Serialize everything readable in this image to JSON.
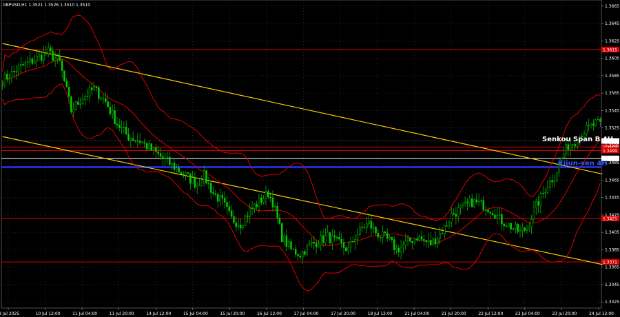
{
  "chart_data": {
    "type": "candlestick",
    "title": "GBPUSD,H1  1.3521 1.3526 1.3510 1.3510",
    "xlabel": "",
    "ylabel": "",
    "ylim": [
      1.3318,
      1.3672
    ],
    "y_ticks": [
      "1.3665",
      "1.3645",
      "1.3625",
      "1.3605",
      "1.3585",
      "1.3565",
      "1.3545",
      "1.3525",
      "1.3505",
      "1.3485",
      "1.3465",
      "1.3445",
      "1.3425",
      "1.3405",
      "1.3385",
      "1.3365",
      "1.3345",
      "1.3325"
    ],
    "x_ticks": [
      "9 Jul 2025",
      "10 Jul 12:00",
      "11 Jul 04:00",
      "11 Jul 20:00",
      "14 Jul 12:00",
      "15 Jul 04:00",
      "15 Jul 20:00",
      "16 Jul 12:00",
      "17 Jul 04:00",
      "17 Jul 20:00",
      "18 Jul 12:00",
      "21 Jul 04:00",
      "21 Jul 20:00",
      "22 Jul 12:00",
      "23 Jul 04:00",
      "23 Jul 20:00",
      "24 Jul 12:00"
    ],
    "bar_count": 262,
    "close_path": [
      [
        0,
        1.358
      ],
      [
        8,
        1.3595
      ],
      [
        15,
        1.3605
      ],
      [
        20,
        1.3612
      ],
      [
        25,
        1.36
      ],
      [
        30,
        1.3545
      ],
      [
        35,
        1.356
      ],
      [
        40,
        1.357
      ],
      [
        45,
        1.3555
      ],
      [
        50,
        1.353
      ],
      [
        55,
        1.3515
      ],
      [
        60,
        1.351
      ],
      [
        65,
        1.35
      ],
      [
        70,
        1.349
      ],
      [
        75,
        1.348
      ],
      [
        80,
        1.347
      ],
      [
        85,
        1.346
      ],
      [
        88,
        1.347
      ],
      [
        92,
        1.345
      ],
      [
        96,
        1.344
      ],
      [
        100,
        1.342
      ],
      [
        104,
        1.3415
      ],
      [
        108,
        1.343
      ],
      [
        112,
        1.344
      ],
      [
        116,
        1.345
      ],
      [
        118,
        1.344
      ],
      [
        122,
        1.34
      ],
      [
        126,
        1.3385
      ],
      [
        130,
        1.338
      ],
      [
        134,
        1.339
      ],
      [
        138,
        1.3395
      ],
      [
        142,
        1.34
      ],
      [
        145,
        1.3395
      ],
      [
        148,
        1.339
      ],
      [
        151,
        1.3385
      ],
      [
        154,
        1.34
      ],
      [
        157,
        1.341
      ],
      [
        160,
        1.3415
      ],
      [
        163,
        1.3405
      ],
      [
        166,
        1.34
      ],
      [
        169,
        1.3395
      ],
      [
        172,
        1.3385
      ],
      [
        175,
        1.339
      ],
      [
        178,
        1.3395
      ],
      [
        181,
        1.34
      ],
      [
        184,
        1.3395
      ],
      [
        187,
        1.3392
      ],
      [
        190,
        1.34
      ],
      [
        193,
        1.341
      ],
      [
        196,
        1.3425
      ],
      [
        199,
        1.343
      ],
      [
        202,
        1.3435
      ],
      [
        205,
        1.344
      ],
      [
        208,
        1.3438
      ],
      [
        211,
        1.3435
      ],
      [
        214,
        1.343
      ],
      [
        217,
        1.342
      ],
      [
        220,
        1.3415
      ],
      [
        223,
        1.341
      ],
      [
        226,
        1.3405
      ],
      [
        229,
        1.341
      ],
      [
        232,
        1.343
      ],
      [
        235,
        1.3445
      ],
      [
        238,
        1.346
      ],
      [
        241,
        1.347
      ],
      [
        244,
        1.349
      ],
      [
        247,
        1.3505
      ],
      [
        250,
        1.351
      ],
      [
        253,
        1.352
      ],
      [
        256,
        1.3525
      ],
      [
        259,
        1.353
      ],
      [
        262,
        1.3528
      ]
    ],
    "last_close": 1.351,
    "horizontal_levels": [
      {
        "value": 1.3615,
        "label": "1.3615",
        "color": "#dd0000"
      },
      {
        "value": 1.3503,
        "label": "1.3503",
        "color": "#dd0000"
      },
      {
        "value": 1.3499,
        "label": "1.3499",
        "color": "#dd0000"
      },
      {
        "value": 1.349,
        "label": "1.3490",
        "color": "#ffffff"
      },
      {
        "value": 1.348,
        "label": "",
        "color": "#2233ff"
      },
      {
        "value": 1.3421,
        "label": "1.3421",
        "color": "#dd0000"
      },
      {
        "value": 1.3371,
        "label": "1.3371",
        "color": "#dd0000"
      }
    ],
    "last_price_label": "1.3510",
    "annotations": [
      {
        "text": "Senkou Span B 4H",
        "color": "#ffffff"
      },
      {
        "text": "Kijun-sen 4H",
        "color": "#3355ff"
      }
    ],
    "trend_lines": [
      {
        "from": [
          0,
          1.3622
        ],
        "to": [
          262,
          1.3472
        ]
      },
      {
        "from": [
          0,
          1.3515
        ],
        "to": [
          262,
          1.3368
        ]
      }
    ]
  },
  "colors": {
    "background": "#000000",
    "bull": "#00cc00",
    "bear": "#00cc00",
    "ichimoku": "#dd0000",
    "trend": "#ffcc00",
    "kijun": "#2233ff",
    "senkou_b": "#ffffff",
    "grid": "#4a4a4a"
  }
}
